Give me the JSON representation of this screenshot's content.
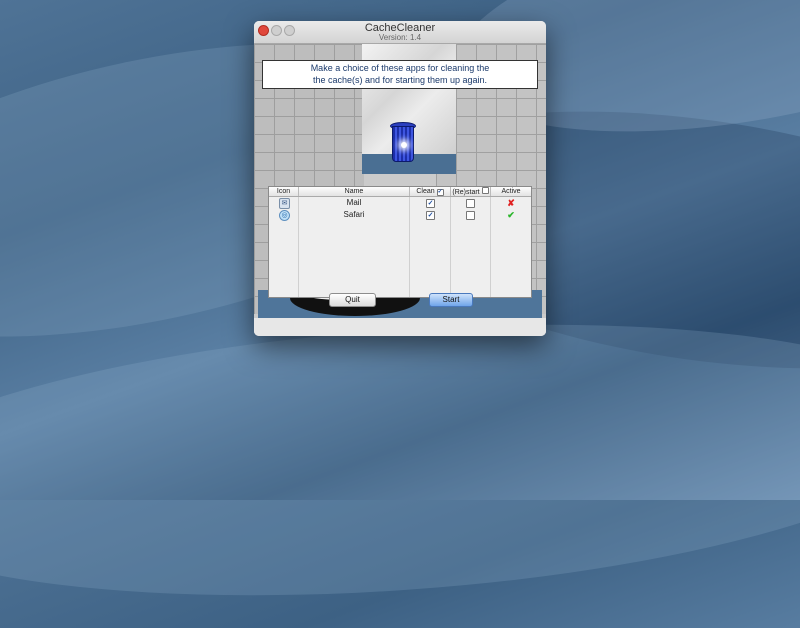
{
  "window": {
    "title": "CacheCleaner",
    "version": "Version: 1.4"
  },
  "instructions": {
    "line1": "Make a choice of these apps for cleaning the",
    "line2": "the cache(s) and for starting them up again."
  },
  "table": {
    "columns": {
      "icon": "Icon",
      "name": "Name",
      "clean": "Clean",
      "restart": "(Re)start",
      "active": "Active"
    },
    "header_clean_checked": true,
    "header_restart_checked": false,
    "rows": [
      {
        "icon": "mail-icon",
        "name": "Mail",
        "clean": true,
        "restart": false,
        "active": false
      },
      {
        "icon": "safari-icon",
        "name": "Safari",
        "clean": true,
        "restart": false,
        "active": true
      }
    ]
  },
  "buttons": {
    "quit": "Quit",
    "start": "Start"
  },
  "colors": {
    "active_true": "#2bb52b",
    "active_false": "#e02020",
    "default_button": "#6fa5ea"
  }
}
